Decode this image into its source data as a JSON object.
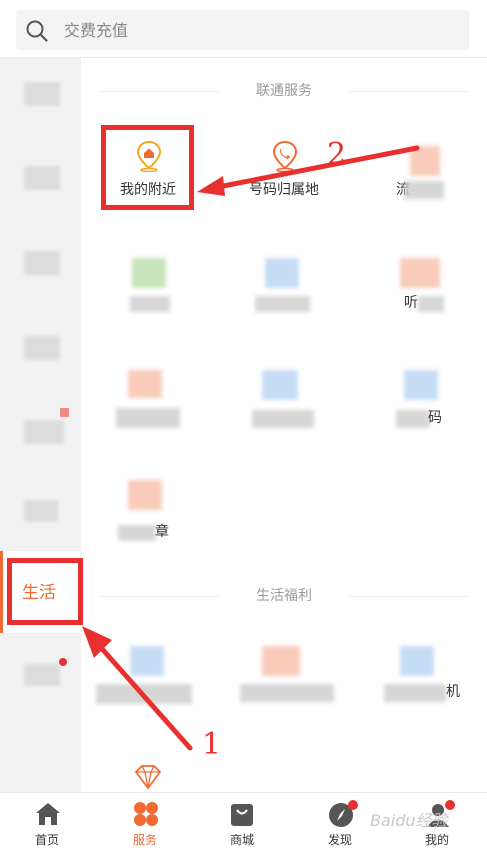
{
  "search": {
    "placeholder": "交费充值"
  },
  "sidebar": {
    "active_label": "生活"
  },
  "sections": {
    "unicom": {
      "title": "联通服务"
    },
    "life": {
      "title": "生活福利"
    }
  },
  "items": {
    "nearby": {
      "label": "我的附近",
      "icon": "location-home-icon"
    },
    "number_location": {
      "label": "号码归属地",
      "icon": "location-phone-icon"
    },
    "item3_partial": {
      "label": "流"
    },
    "item6_partial": {
      "label": "听"
    },
    "item9_partial": {
      "label": "码"
    },
    "item10_partial": {
      "label": "章"
    },
    "item11_partial": {
      "label": "机"
    }
  },
  "annotations": {
    "one": "1",
    "two": "2"
  },
  "bottom_nav": {
    "items": [
      {
        "label": "首页",
        "icon": "home-icon"
      },
      {
        "label": "服务",
        "icon": "service-icon",
        "active": true
      },
      {
        "label": "商城",
        "icon": "shopping-bag-icon"
      },
      {
        "label": "发现",
        "icon": "compass-icon"
      },
      {
        "label": "我的",
        "icon": "user-icon"
      }
    ]
  },
  "colors": {
    "accent": "#f26a32",
    "annotation_red": "#e8312f"
  },
  "watermark": {
    "text": "Baidu经验"
  }
}
